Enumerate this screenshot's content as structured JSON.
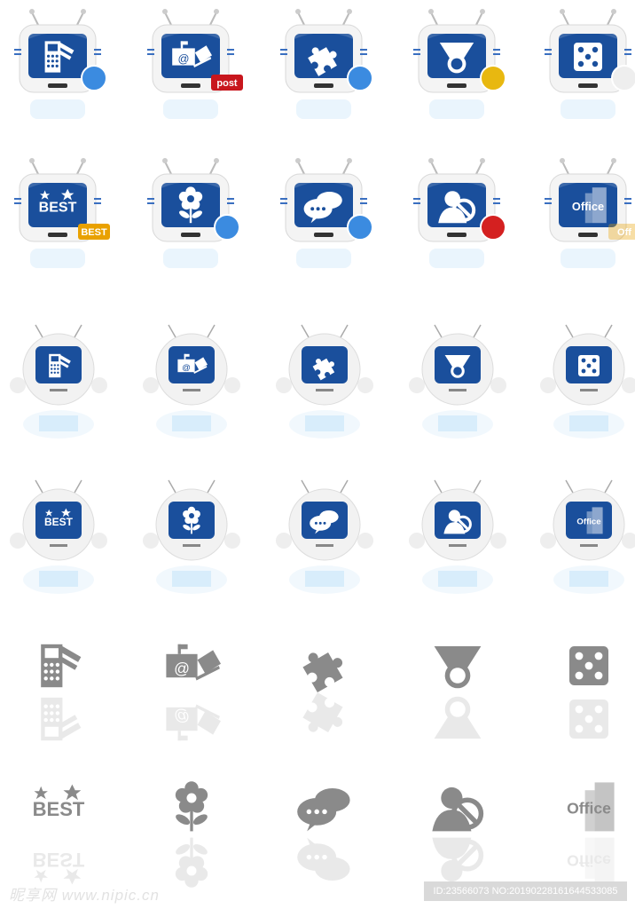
{
  "icon_rows": [
    {
      "style": "tv",
      "items": [
        {
          "name": "payment-terminal",
          "label": "$"
        },
        {
          "name": "mail",
          "label": "@",
          "badge": "post"
        },
        {
          "name": "puzzle"
        },
        {
          "name": "medal"
        },
        {
          "name": "dice"
        }
      ]
    },
    {
      "style": "tv",
      "items": [
        {
          "name": "best",
          "label": "BEST",
          "badge": "BEST"
        },
        {
          "name": "flower"
        },
        {
          "name": "chat"
        },
        {
          "name": "user-block"
        },
        {
          "name": "office",
          "label": "Office",
          "badge": "Off"
        }
      ]
    },
    {
      "style": "robot",
      "items": [
        {
          "name": "payment-terminal",
          "label": "$"
        },
        {
          "name": "mail",
          "label": "@"
        },
        {
          "name": "puzzle"
        },
        {
          "name": "medal"
        },
        {
          "name": "dice"
        }
      ]
    },
    {
      "style": "robot",
      "items": [
        {
          "name": "best",
          "label": "BEST"
        },
        {
          "name": "flower"
        },
        {
          "name": "chat"
        },
        {
          "name": "user-block"
        },
        {
          "name": "office",
          "label": "Office"
        }
      ]
    },
    {
      "style": "flat",
      "items": [
        {
          "name": "payment-terminal",
          "label": "$"
        },
        {
          "name": "mail",
          "label": "@"
        },
        {
          "name": "puzzle"
        },
        {
          "name": "medal"
        },
        {
          "name": "dice"
        }
      ]
    },
    {
      "style": "flat",
      "items": [
        {
          "name": "best",
          "label": "BEST"
        },
        {
          "name": "flower"
        },
        {
          "name": "chat"
        },
        {
          "name": "user-block"
        },
        {
          "name": "office",
          "label": "Office"
        }
      ]
    }
  ],
  "colors": {
    "screen": "#1a4f9c",
    "screen_dark": "#0b2f6b",
    "frame": "#f2f2f2",
    "flat_gray": "#8a8a8a",
    "accent_red": "#c8161d"
  },
  "watermark": {
    "site": "昵享网 www.nipic.cn",
    "id_text": "ID:23566073 NO:20190228161644533085"
  }
}
